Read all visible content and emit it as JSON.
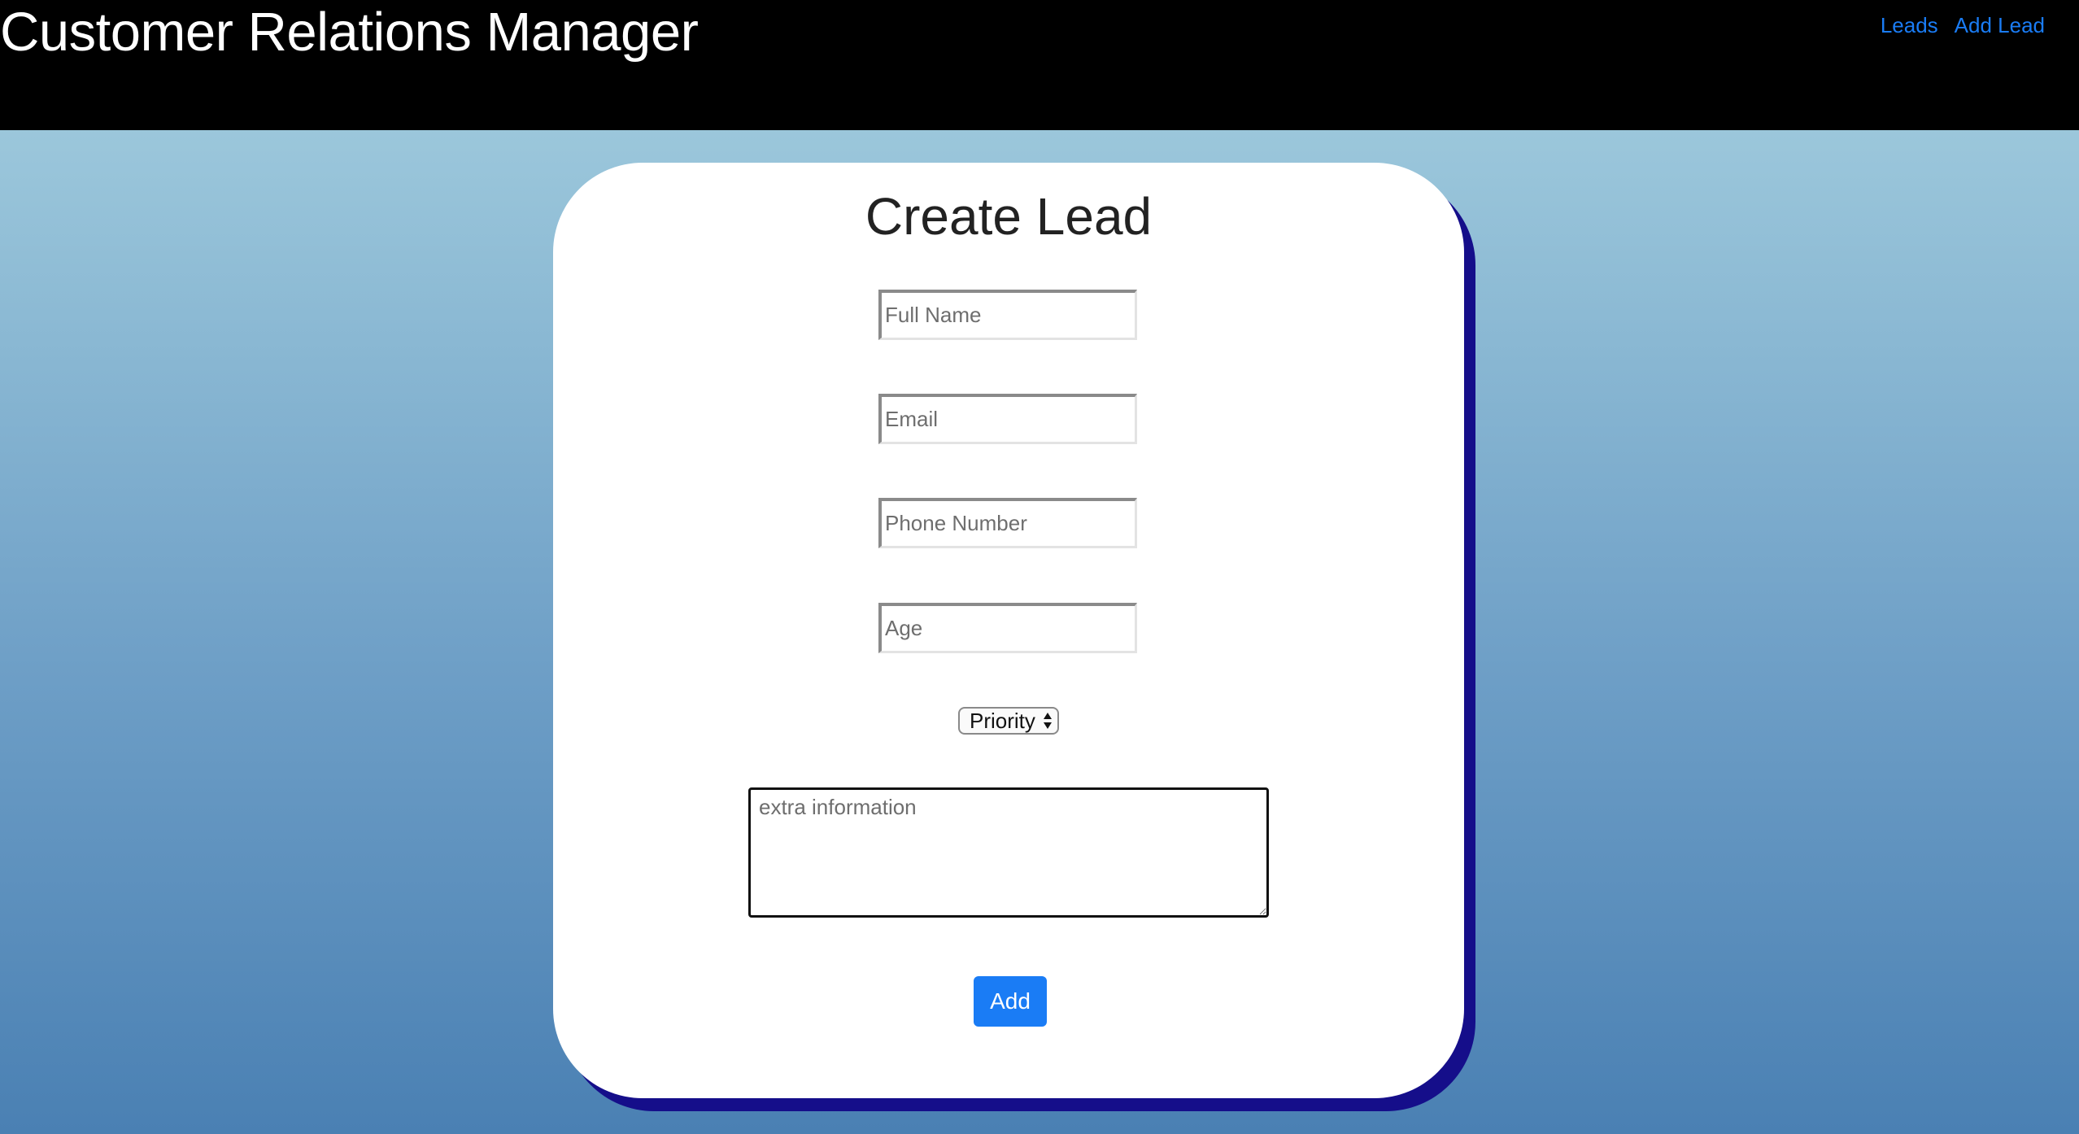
{
  "header": {
    "title": "Customer Relations Manager",
    "nav": [
      {
        "label": "Leads"
      },
      {
        "label": "Add Lead"
      }
    ]
  },
  "form": {
    "title": "Create Lead",
    "fields": {
      "full_name": {
        "placeholder": "Full Name",
        "value": ""
      },
      "email": {
        "placeholder": "Email",
        "value": ""
      },
      "phone": {
        "placeholder": "Phone Number",
        "value": ""
      },
      "age": {
        "placeholder": "Age",
        "value": ""
      }
    },
    "priority": {
      "selected": "Priority",
      "icon": "up-down-arrows-icon"
    },
    "extra_info": {
      "placeholder": "extra information"
    },
    "submit_label": "Add"
  },
  "colors": {
    "topbar": "#000000",
    "link": "#1a7cf5",
    "card": "#ffffff",
    "card_shadow": "#150e8a",
    "button": "#1a7cf5",
    "background_top": "#a6d0e0",
    "background_bottom": "#4a80b3"
  }
}
